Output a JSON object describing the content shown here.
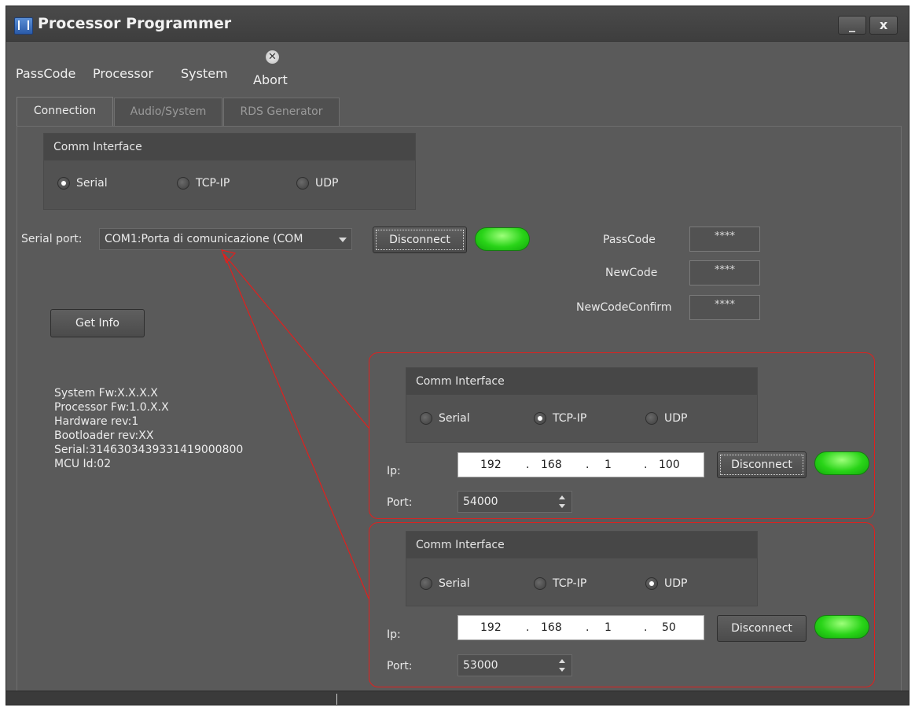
{
  "window": {
    "title": "Processor Programmer",
    "minimize_glyph": "_",
    "close_glyph": "x"
  },
  "menu": {
    "items": [
      "PassCode",
      "Processor",
      "System"
    ],
    "abort_label": "Abort",
    "abort_icon": "close-circle-icon"
  },
  "tabs": [
    {
      "label": "Connection",
      "active": true
    },
    {
      "label": "Audio/System",
      "active": false
    },
    {
      "label": "RDS Generator",
      "active": false
    }
  ],
  "comm_main": {
    "header": "Comm Interface",
    "options": [
      {
        "label": "Serial",
        "checked": true
      },
      {
        "label": "TCP-IP",
        "checked": false
      },
      {
        "label": "UDP",
        "checked": false
      }
    ]
  },
  "serial": {
    "label": "Serial port:",
    "value": "COM1:Porta di comunicazione (COM",
    "connect_label": "Disconnect",
    "status_color": "#29d418"
  },
  "passcodes": {
    "passcode_label": "PassCode",
    "passcode_value": "****",
    "newcode_label": "NewCode",
    "newcode_value": "****",
    "confirm_label": "NewCodeConfirm",
    "confirm_value": "****"
  },
  "get_info_label": "Get Info",
  "info_lines": [
    "System Fw:X.X.X.X",
    "Processor Fw:1.0.X.X",
    "Hardware rev:1",
    "Bootloader rev:XX",
    "Serial:314630343933141900080​0",
    "MCU Id:02"
  ],
  "tcp_panel": {
    "header": "Comm Interface",
    "options": [
      {
        "label": "Serial",
        "checked": false
      },
      {
        "label": "TCP-IP",
        "checked": true
      },
      {
        "label": "UDP",
        "checked": false
      }
    ],
    "ip_label": "Ip:",
    "ip": [
      "192",
      "168",
      "1",
      "100"
    ],
    "ip_dot": ".",
    "port_label": "Port:",
    "port": "54000",
    "connect_label": "Disconnect"
  },
  "udp_panel": {
    "header": "Comm Interface",
    "options": [
      {
        "label": "Serial",
        "checked": false
      },
      {
        "label": "TCP-IP",
        "checked": false
      },
      {
        "label": "UDP",
        "checked": true
      }
    ],
    "ip_label": "Ip:",
    "ip": [
      "192",
      "168",
      "1",
      "50"
    ],
    "ip_dot": ".",
    "port_label": "Port:",
    "port": "53000",
    "connect_label": "Disconnect"
  },
  "annotation_color": "#e0201e"
}
